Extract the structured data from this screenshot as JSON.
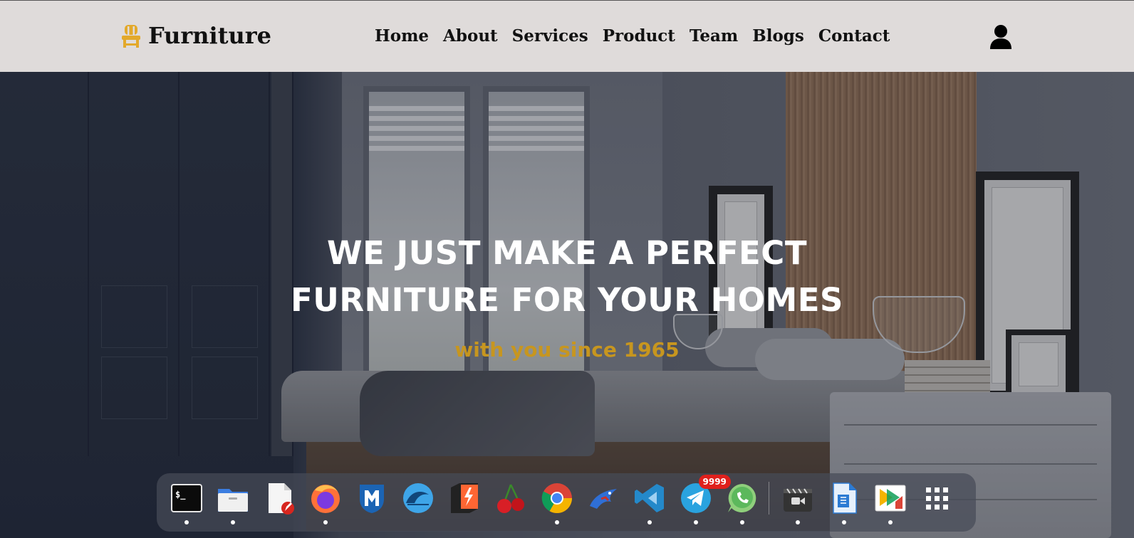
{
  "navbar": {
    "brand": "Furniture",
    "brand_icon": "chair-icon",
    "brand_color": "#e3a92b",
    "links": [
      "Home",
      "About",
      "Services",
      "Product",
      "Team",
      "Blogs",
      "Contact"
    ],
    "user_icon": "user-icon"
  },
  "hero": {
    "title_line1": "WE JUST MAKE A PERFECT",
    "title_line2": "FURNITURE FOR YOUR HOMES",
    "subtitle": "with you since 1965",
    "subtitle_color": "#c7961f"
  },
  "dock": {
    "items": [
      {
        "name": "terminal-icon",
        "running": true
      },
      {
        "name": "files-icon",
        "running": true
      },
      {
        "name": "text-editor-icon",
        "running": false
      },
      {
        "name": "firefox-icon",
        "running": true
      },
      {
        "name": "metasploit-icon",
        "running": false
      },
      {
        "name": "wireshark-icon",
        "running": false
      },
      {
        "name": "burp-suite-icon",
        "running": false
      },
      {
        "name": "cherrytree-icon",
        "running": false
      },
      {
        "name": "chrome-icon",
        "running": true
      },
      {
        "name": "kali-dragon-icon",
        "running": false
      },
      {
        "name": "vscode-icon",
        "running": true
      },
      {
        "name": "telegram-icon",
        "running": true,
        "badge": "9999"
      },
      {
        "name": "whatsapp-icon",
        "running": true
      },
      {
        "name": "screen-recorder-icon",
        "running": true
      },
      {
        "name": "libreoffice-writer-icon",
        "running": true
      },
      {
        "name": "libreoffice-impress-icon",
        "running": true
      },
      {
        "name": "app-grid-icon",
        "running": false
      }
    ]
  }
}
